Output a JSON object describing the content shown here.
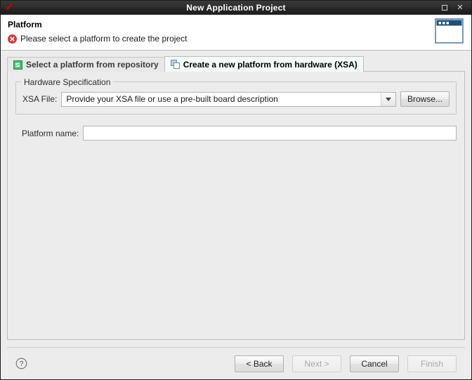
{
  "window": {
    "title": "New Application Project",
    "logo_icon": "xilinx-vitis-logo",
    "maximize_label": "❐",
    "close_label": "✕"
  },
  "header": {
    "title": "Platform",
    "message": "Please select a platform to create the project",
    "error_icon": "error-circle-icon",
    "banner_icon": "dialog-window-banner-icon",
    "error_color": "#d43b3b",
    "banner_color": "#1f4e79"
  },
  "tabs": [
    {
      "label": "Select a platform from repository",
      "icon": "green-platform-icon",
      "active": false
    },
    {
      "label": "Create a new platform from hardware (XSA)",
      "icon": "blue-windows-icon",
      "active": true
    }
  ],
  "group": {
    "title": "Hardware Specification",
    "xsa_label": "XSA File:",
    "xsa_value": "Provide your XSA file or use a pre-built board description",
    "xsa_dropdown_icon": "chevron-down-icon",
    "browse_label": "Browse..."
  },
  "platform_name": {
    "label": "Platform name:",
    "value": "",
    "placeholder": ""
  },
  "footer": {
    "help_icon": "help-question-icon",
    "buttons": [
      {
        "label": "< Back",
        "disabled": false
      },
      {
        "label": "Next >",
        "disabled": true
      },
      {
        "label": "Cancel",
        "disabled": false
      },
      {
        "label": "Finish",
        "disabled": true
      }
    ]
  }
}
